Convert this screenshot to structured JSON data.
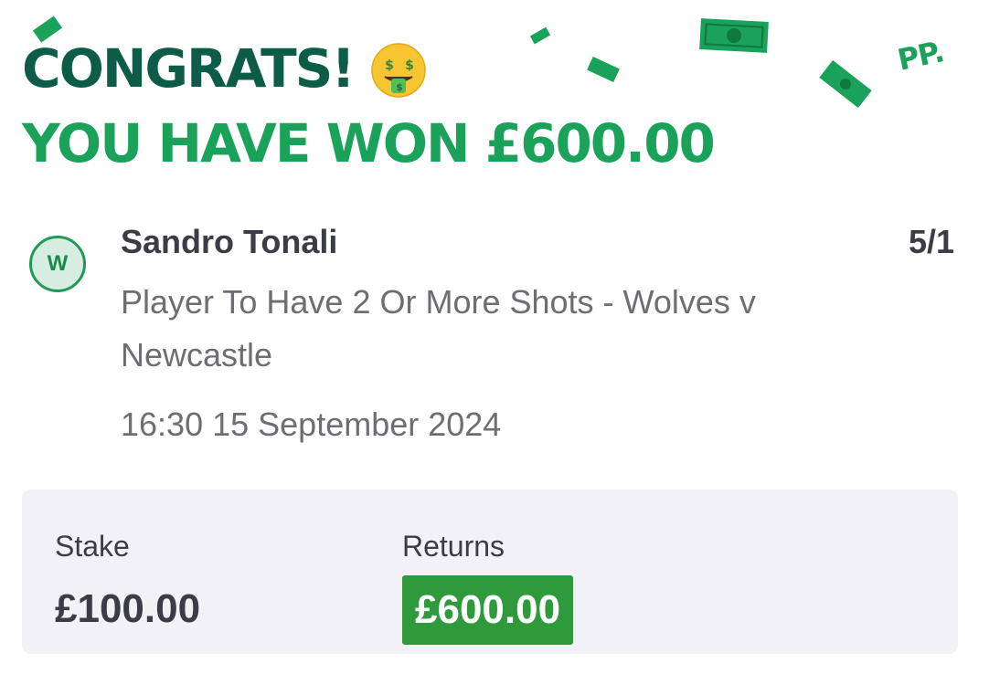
{
  "header": {
    "line1": "CONGRATS!",
    "line2": "YOU HAVE WON £600.00",
    "emoji": "money-mouth-face-icon",
    "logo": "PP."
  },
  "bet": {
    "result_badge": "W",
    "selection": "Sandro Tonali",
    "odds": "5/1",
    "market": "Player To Have 2 Or More Shots - Wolves v Newcastle",
    "event_time": "16:30 15 September 2024"
  },
  "summary": {
    "stake_label": "Stake",
    "stake_value": "£100.00",
    "returns_label": "Returns",
    "returns_value": "£600.00"
  },
  "colors": {
    "headline_dark_green": "#0c5c48",
    "headline_green": "#1aa25a",
    "returns_green": "#2e9a3c",
    "panel_bg": "#f1f1f6",
    "text_dark": "#3c3c46",
    "text_grey": "#6d6d73"
  }
}
